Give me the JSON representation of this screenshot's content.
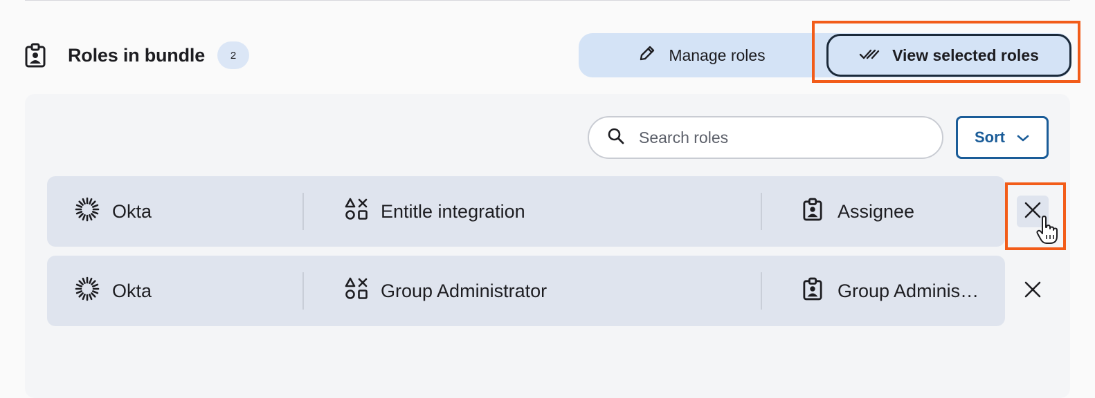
{
  "header": {
    "title": "Roles in bundle",
    "count": "2",
    "icon": "role-badge-icon"
  },
  "view_toggle": {
    "manage_label": "Manage roles",
    "manage_icon": "pencil-icon",
    "view_label": "View selected roles",
    "view_icon": "double-check-icon",
    "selected": "View selected roles"
  },
  "toolbar": {
    "search_placeholder": "Search roles",
    "search_value": "",
    "sort_label": "Sort"
  },
  "roles": [
    {
      "app": "Okta",
      "resource": "Entitle integration",
      "role": "Assignee"
    },
    {
      "app": "Okta",
      "resource": "Group Administrator",
      "role": "Group Administrator"
    }
  ],
  "colors": {
    "accent": "#1a5c98",
    "toggle_bg": "#d4e3f6",
    "row_bg": "#dfe4ee",
    "highlight": "#f25c19"
  }
}
